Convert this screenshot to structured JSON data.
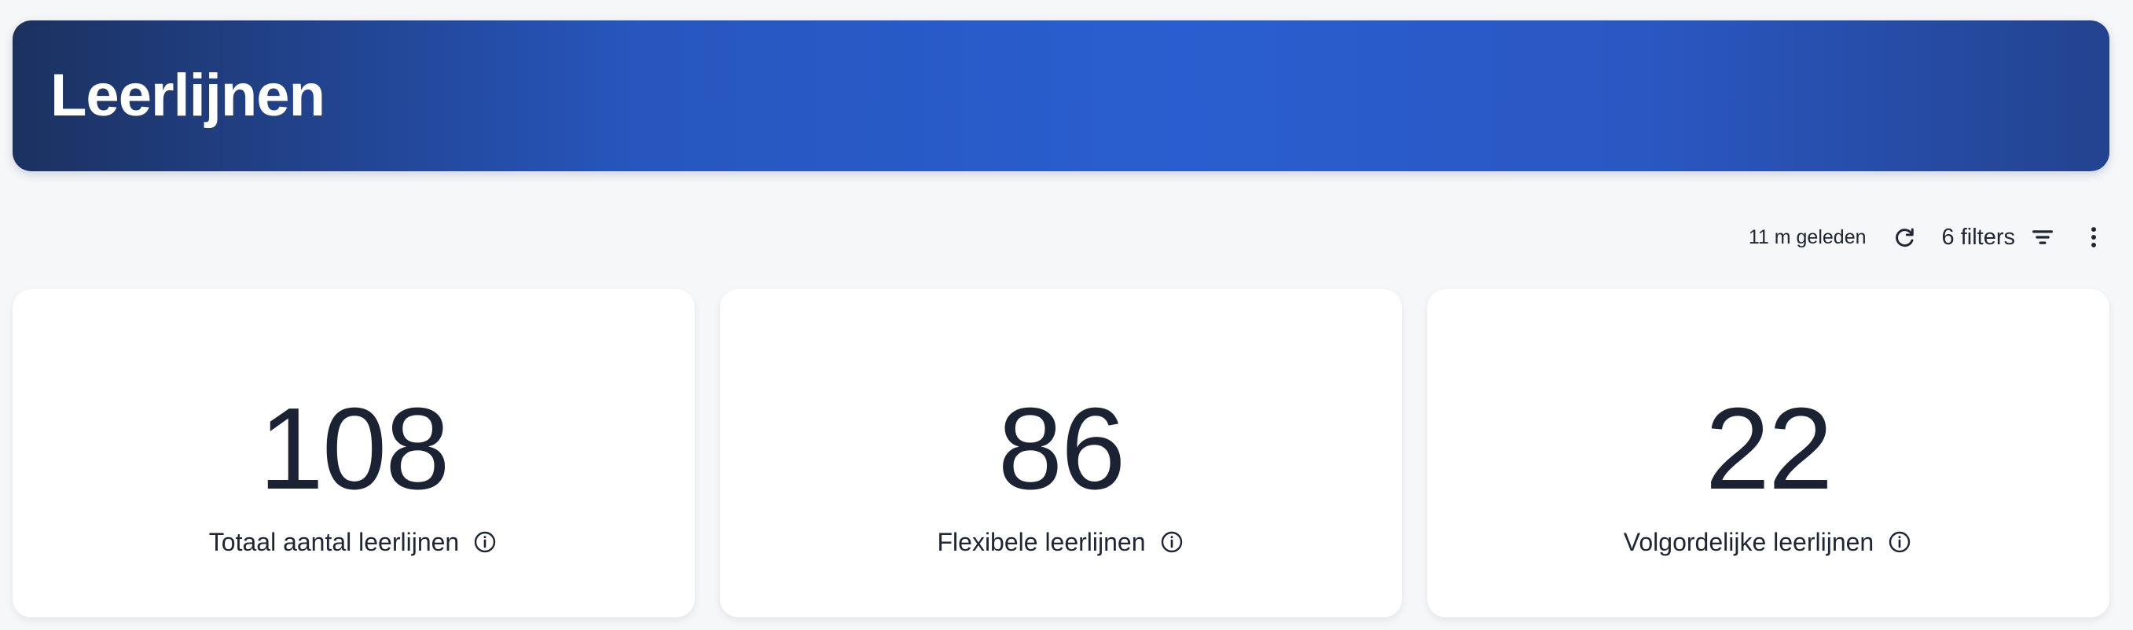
{
  "header": {
    "title": "Leerlijnen"
  },
  "toolbar": {
    "last_updated": "11 m geleden",
    "refresh_icon": "refresh-icon",
    "filters_label": "6 filters",
    "filter_icon": "filter-icon",
    "more_icon": "more-vertical-icon"
  },
  "cards": [
    {
      "value": "108",
      "label": "Totaal aantal leerlijnen",
      "icon": "info-icon"
    },
    {
      "value": "86",
      "label": "Flexibele leerlijnen",
      "icon": "info-icon"
    },
    {
      "value": "22",
      "label": "Volgordelijke leerlijnen",
      "icon": "info-icon"
    }
  ],
  "colors": {
    "background": "#f6f7f9",
    "hero_start": "#1c3160",
    "hero_mid": "#2a5ed0",
    "hero_end": "#23438f",
    "text": "#1b2233",
    "card_background": "#ffffff"
  }
}
